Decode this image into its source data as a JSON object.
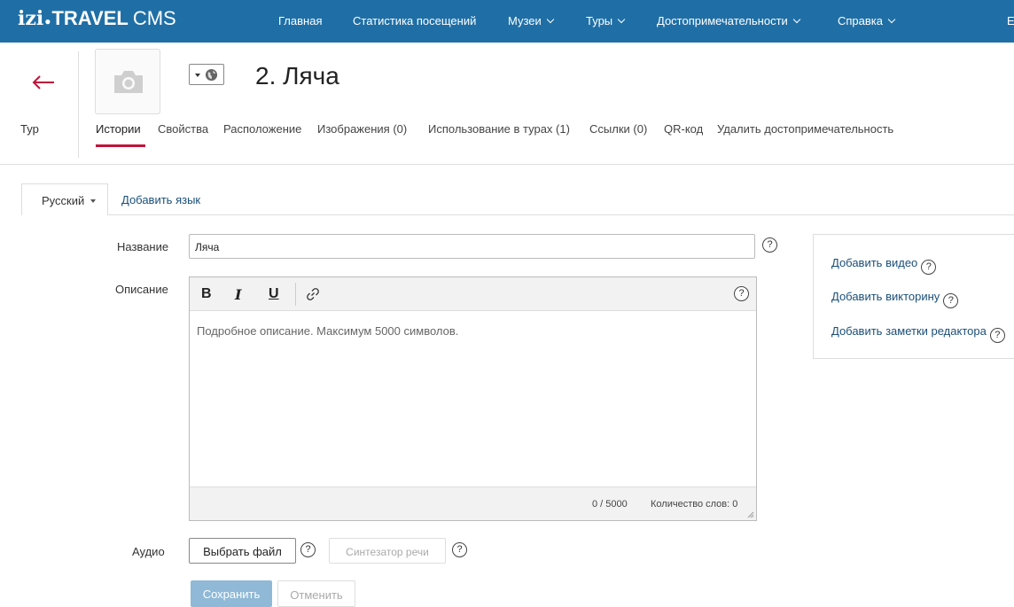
{
  "topbar": {
    "logo_izi": "izi",
    "logo_dot": "●",
    "logo_travel": "TRAVEL",
    "logo_cms": "CMS",
    "nav": [
      {
        "label": "Главная"
      },
      {
        "label": "Статистика посещений"
      },
      {
        "label": "Музеи"
      },
      {
        "label": "Туры"
      },
      {
        "label": "Достопримечательности"
      },
      {
        "label": "Справка"
      }
    ],
    "edge_label": "E"
  },
  "header": {
    "back_label": "Тур",
    "title": "2. Ляча",
    "tabs": [
      {
        "label": "Истории"
      },
      {
        "label": "Свойства"
      },
      {
        "label": "Расположение"
      },
      {
        "label": "Изображения (0)"
      },
      {
        "label": "Использование в турах (1)"
      },
      {
        "label": "Ссылки (0)"
      },
      {
        "label": "QR-код"
      },
      {
        "label": "Удалить достопримечательность"
      }
    ]
  },
  "language": {
    "current": "Русский",
    "add_label": "Добавить язык"
  },
  "form": {
    "name_label": "Название",
    "name_value": "Ляча",
    "description_label": "Описание",
    "editor": {
      "bold": "B",
      "italic": "I",
      "underline": "U",
      "placeholder": "Подробное описание. Максимум 5000 символов.",
      "char_count": "0 / 5000",
      "word_count": "Количество слов: 0"
    },
    "audio_label": "Аудио",
    "choose_file": "Выбрать файл",
    "speech_synth": "Синтезатор речи",
    "save": "Сохранить",
    "cancel": "Отменить",
    "help_glyph": "?"
  },
  "side_panel": {
    "add_video": "Добавить видео",
    "add_quiz": "Добавить викторину",
    "add_notes": "Добавить заметки редактора"
  },
  "colors": {
    "topbar": "#1f6fa6",
    "accent": "#c0123b",
    "link": "#1a4f7a",
    "save_disabled": "#8fb9d6"
  }
}
